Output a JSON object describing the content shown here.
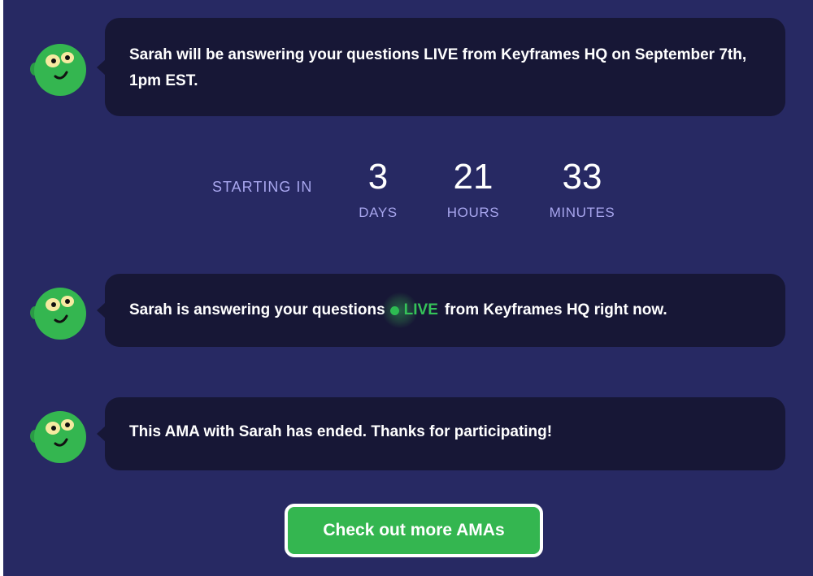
{
  "messages": {
    "scheduled": "Sarah will be answering your questions LIVE from Keyframes HQ on September 7th, 1pm EST.",
    "live_before": "Sarah is answering your questions",
    "live_badge": "LIVE",
    "live_after": "from Keyframes HQ right now.",
    "ended": "This AMA with Sarah has ended. Thanks for participating!"
  },
  "countdown": {
    "label": "STARTING IN",
    "units": [
      {
        "value": "3",
        "name": "DAYS"
      },
      {
        "value": "21",
        "name": "HOURS"
      },
      {
        "value": "33",
        "name": "MINUTES"
      }
    ]
  },
  "cta": {
    "label": "Check out more AMAs"
  },
  "avatar": {
    "icon": "green-goblin-face-icon"
  },
  "colors": {
    "panel_bg": "#272963",
    "bubble_bg": "#171736",
    "accent_green": "#34b650",
    "muted_text": "#a8a6ee"
  }
}
